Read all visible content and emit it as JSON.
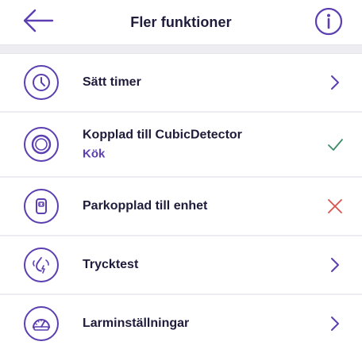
{
  "header": {
    "title": "Fler funktioner",
    "back_icon": "arrow-left-icon",
    "info_icon": "info-icon"
  },
  "colors": {
    "accent": "#5b3fb0",
    "check": "#3d8c6a",
    "cross": "#d9534f",
    "text": "#1f1b3a",
    "divider": "#ececf1"
  },
  "items": [
    {
      "label": "Sätt timer",
      "sublabel": "",
      "icon": "clock-icon",
      "trailing": "chevron-right-icon"
    },
    {
      "label": "Kopplad till CubicDetector",
      "sublabel": "Kök",
      "icon": "detector-ring-icon",
      "trailing": "check-icon"
    },
    {
      "label": "Parkopplad till enhet",
      "sublabel": "",
      "icon": "device-icon",
      "trailing": "cross-icon"
    },
    {
      "label": "Trycktest",
      "sublabel": "",
      "icon": "pressure-test-icon",
      "trailing": "chevron-right-icon"
    },
    {
      "label": "Larminställningar",
      "sublabel": "",
      "icon": "gauge-icon",
      "trailing": "chevron-right-icon"
    }
  ]
}
